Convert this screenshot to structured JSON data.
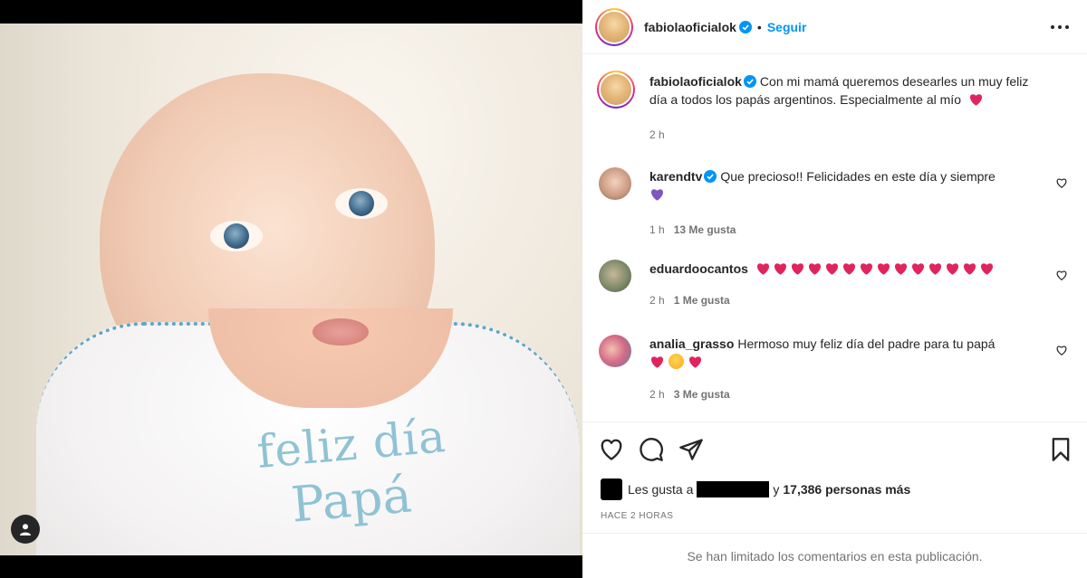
{
  "post": {
    "author": "fabiolaoficialok",
    "follow_label": "Seguir",
    "separator": "•",
    "bib_line1": "feliz día",
    "bib_line2": "Papá",
    "caption": "Con mi mamá queremos desearles un muy feliz día a todos los papás argentinos. Especialmente al mío",
    "caption_time": "2 h"
  },
  "comments": [
    {
      "user": "karendtv",
      "text": "Que precioso!! Felicidades en este día y siempre",
      "time": "1 h",
      "likes": "13 Me gusta"
    },
    {
      "user": "eduardoocantos",
      "text": "",
      "time": "2 h",
      "likes": "1 Me gusta"
    },
    {
      "user": "analia_grasso",
      "text": "Hermoso muy feliz día del padre para tu papá",
      "time": "2 h",
      "likes": "3 Me gusta"
    }
  ],
  "likes_line": {
    "prefix": "Les gusta a",
    "suffix": "y",
    "count": "17,386 personas más"
  },
  "posted_ago": "HACE 2 HORAS",
  "comments_limited": "Se han limitado los comentarios en esta publicación.",
  "icons": {
    "verified": "verified-badge-icon",
    "heart": "heart-icon",
    "comment": "comment-icon",
    "share": "share-icon",
    "save": "bookmark-icon",
    "more": "more-icon",
    "user_tag": "user-icon"
  },
  "colors": {
    "accent": "#0095f6",
    "heart_red": "#e0245e",
    "purple_heart": "#7e57c2",
    "muted": "#737373"
  }
}
